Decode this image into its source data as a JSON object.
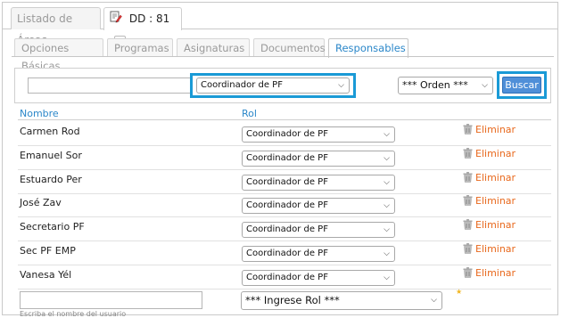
{
  "outer_tabs": [
    {
      "label": "Listado de Áreas"
    },
    {
      "label": "DD : 81"
    }
  ],
  "close_glyph": "×",
  "inner_tabs": [
    {
      "label": "Opciones Básicas"
    },
    {
      "label": "Programas"
    },
    {
      "label": "Asignaturas"
    },
    {
      "label": "Documentos"
    },
    {
      "label": "Responsables",
      "active": true
    }
  ],
  "search": {
    "text_value": "",
    "role_selected": "Coordinador de PF",
    "order_selected": "*** Orden ***",
    "buscar_label": "Buscar"
  },
  "table": {
    "headers": {
      "name": "Nombre",
      "role": "Rol"
    },
    "delete_label": "Eliminar",
    "rows": [
      {
        "name": "Carmen Rod",
        "role": "Coordinador de PF"
      },
      {
        "name": "Emanuel Sor",
        "role": "Coordinador de PF"
      },
      {
        "name": "Estuardo Per",
        "role": "Coordinador de PF"
      },
      {
        "name": "José Zav",
        "role": "Coordinador de PF"
      },
      {
        "name": "Secretario PF",
        "role": "Coordinador de PF"
      },
      {
        "name": "Sec PF EMP",
        "role": "Coordinador de PF"
      },
      {
        "name": "Vanesa Yél",
        "role": "Coordinador de PF"
      }
    ]
  },
  "new_row": {
    "user_value": "",
    "hint": "Escriba el nombre del usuario",
    "role_placeholder": "*** Ingrese Rol ***",
    "star": "★"
  },
  "colors": {
    "accent": "#2b87c9",
    "highlight": "#1a9ad6",
    "delete": "#e8681c",
    "button": "#4f8fd8"
  },
  "icons": {
    "doc": "document-edit-icon",
    "close": "close-icon",
    "chevron": "chevron-down-icon",
    "trash": "trash-icon",
    "star": "star-icon"
  }
}
